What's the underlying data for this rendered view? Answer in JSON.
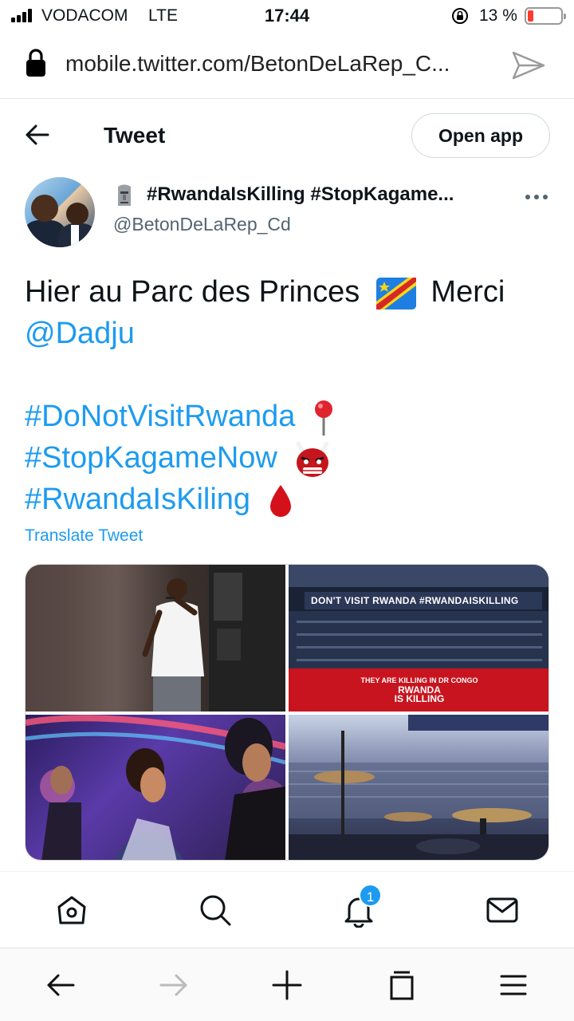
{
  "status_bar": {
    "carrier": "VODACOM",
    "network": "LTE",
    "time": "17:44",
    "battery_percent": "13 %",
    "battery_level": 0.13
  },
  "browser": {
    "url": "mobile.twitter.com/BetonDeLaRep_C..."
  },
  "header": {
    "title": "Tweet",
    "open_app_label": "Open app"
  },
  "author": {
    "display_name": "#RwandaIsKilling #StopKagame...",
    "handle": "@BetonDeLaRep_Cd",
    "name_emoji": "moai-icon"
  },
  "tweet": {
    "text_1": "Hier au Parc des Princes",
    "text_2": "Merci",
    "mention": "@Dadju",
    "hashtags": [
      "#DoNotVisitRwanda",
      "#StopKagameNow",
      "#RwandaIsKiling"
    ],
    "emojis": [
      "dr-congo-flag-icon",
      "round-pushpin-icon",
      "ogre-mask-icon",
      "drop-of-blood-icon"
    ],
    "translate_label": "Translate Tweet"
  },
  "media": {
    "photo_2_banner": "DON'T VISIT RWANDA  #RWANDAISKILLING",
    "photo_2_subline": "THEY ARE KILLING IN DR CONGO",
    "photo_2_main_1": "RWANDA",
    "photo_2_main_2": "IS KILLING"
  },
  "bottom_nav": {
    "items": [
      "home-icon",
      "search-icon",
      "notifications-icon",
      "messages-icon"
    ],
    "notification_count": "1"
  },
  "browser_toolbar": {
    "items": [
      "back-arrow-icon",
      "forward-arrow-icon",
      "new-tab-plus-icon",
      "tabs-icon",
      "menu-icon"
    ]
  }
}
